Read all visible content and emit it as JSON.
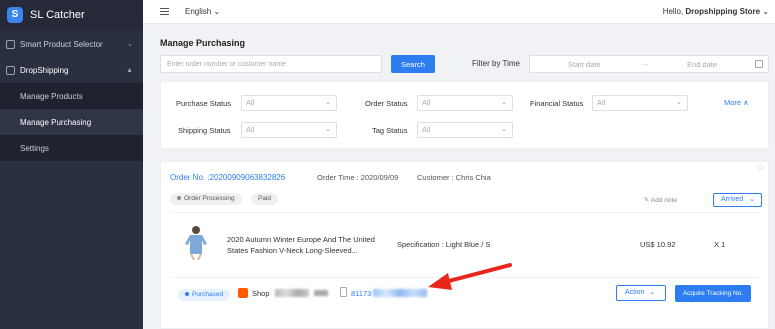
{
  "app": {
    "name": "SL Catcher",
    "logo_letter": "S"
  },
  "sidebar": {
    "items": [
      {
        "label": "Smart Product Selector",
        "icon": "grid-icon"
      },
      {
        "label": "DropShipping",
        "icon": "box-icon"
      }
    ],
    "sub_items": [
      {
        "label": "Manage Products"
      },
      {
        "label": "Manage Purchasing",
        "active": true
      },
      {
        "label": "Settings"
      }
    ]
  },
  "topbar": {
    "language": "English ⌄",
    "hello_prefix": "Hello, ",
    "store": "Dropshipping Store"
  },
  "page": {
    "title": "Manage Purchasing"
  },
  "search": {
    "placeholder": "Enter order number or customer name",
    "button": "Search"
  },
  "filter_time": {
    "label": "Filter by Time",
    "start": "Start date",
    "end": "End date",
    "arrow": "→"
  },
  "filters": {
    "purchase_status": {
      "label": "Purchase Status",
      "value": "All"
    },
    "order_status": {
      "label": "Order Status",
      "value": "All"
    },
    "financial_status": {
      "label": "Financial Status",
      "value": "All"
    },
    "shipping_status": {
      "label": "Shipping Status",
      "value": "All"
    },
    "tag_status": {
      "label": "Tag Status",
      "value": "All"
    },
    "more": "More ∧"
  },
  "order": {
    "number": "Order No. :20200909063832826",
    "time": "Order Time : 2020/09/09",
    "customer": "Customer :  Chris Chia",
    "tags": [
      "Order Processing",
      "Paid"
    ],
    "add_note": "Add note",
    "status_select": "Arrived",
    "product": {
      "name": "2020 Autumn Winter Europe And The United States Fashion V-Neck Long-Sleeved...",
      "specification": "Specification : Light Blue / S",
      "price": "US$ 10.92",
      "quantity": "X 1"
    },
    "purchase": {
      "status": "Purchased",
      "shop": "Shop",
      "tracking_prefix": "81173"
    },
    "action_button": "Action",
    "acquire_button": "Acquire Tracking No."
  },
  "colors": {
    "accent": "#2d7cf0",
    "sidebar_bg": "#2b3040",
    "annotation_arrow": "#e8261c"
  }
}
